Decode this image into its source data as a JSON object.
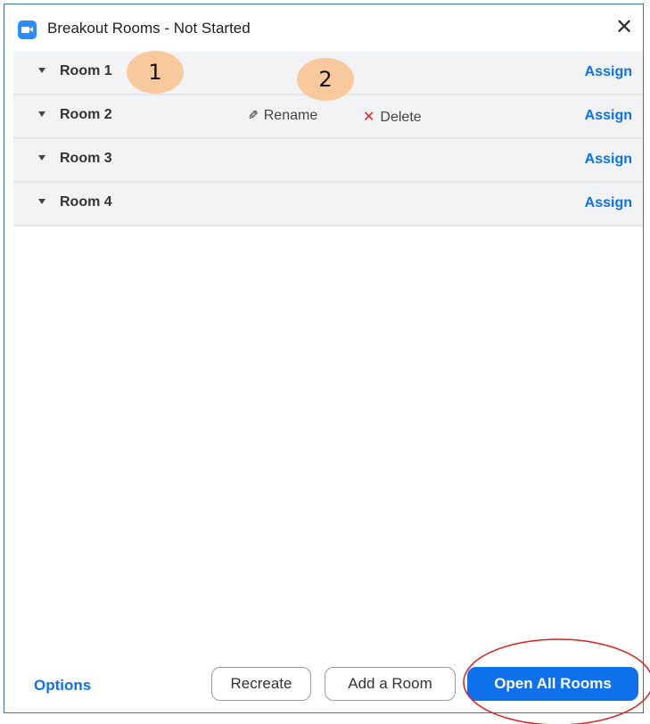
{
  "window": {
    "title": "Breakout Rooms - Not Started",
    "close_glyph": "✕"
  },
  "rooms": [
    {
      "name": "Room 1",
      "assign_label": "Assign"
    },
    {
      "name": "Room 2",
      "assign_label": "Assign",
      "rename_label": "Rename",
      "delete_label": "Delete"
    },
    {
      "name": "Room 3",
      "assign_label": "Assign"
    },
    {
      "name": "Room 4",
      "assign_label": "Assign"
    }
  ],
  "annotations": {
    "badge_1": "1",
    "badge_2": "2"
  },
  "footer": {
    "options_label": "Options",
    "recreate_label": "Recreate",
    "add_room_label": "Add a Room",
    "open_all_label": "Open All Rooms"
  },
  "icons": {
    "app": "zoom-camera-icon",
    "room_expand": "caret-down-icon",
    "rename": "pencil-icon",
    "delete": "x-icon"
  },
  "colors": {
    "accent": "#0e71eb",
    "app_icon": "#2d8cff",
    "row_background": "#f2f3f5",
    "delete_icon": "#e02828",
    "badge": "#f7c99c",
    "callout": "#e02020",
    "window_border": "#3a6fc4"
  }
}
